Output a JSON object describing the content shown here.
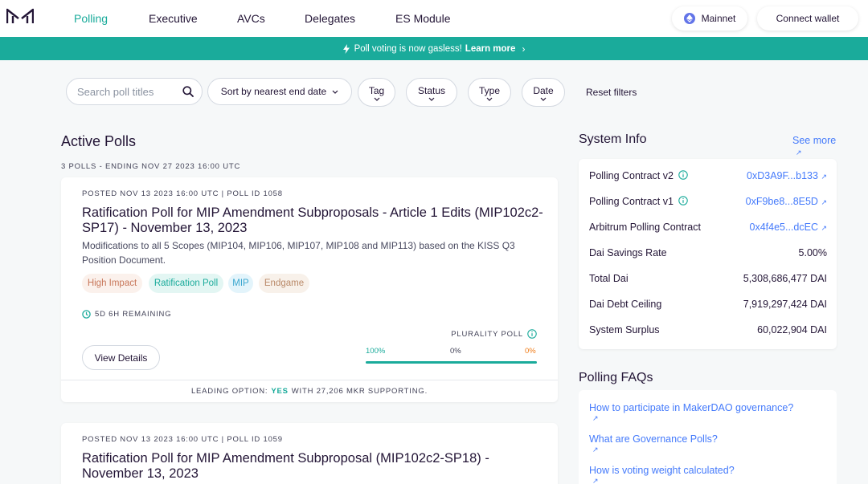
{
  "nav": {
    "items": [
      {
        "label": "Polling",
        "active": true
      },
      {
        "label": "Executive",
        "active": false
      },
      {
        "label": "AVCs",
        "active": false
      },
      {
        "label": "Delegates",
        "active": false
      },
      {
        "label": "ES Module",
        "active": false
      }
    ],
    "network_label": "Mainnet",
    "connect_label": "Connect wallet"
  },
  "banner": {
    "text": "Poll voting is now gasless!",
    "link_text": "Learn more",
    "chevron": "›"
  },
  "filters": {
    "search_placeholder": "Search poll titles",
    "sort_label": "Sort by nearest end date",
    "tag_label": "Tag",
    "status_label": "Status",
    "type_label": "Type",
    "date_label": "Date",
    "reset_label": "Reset filters"
  },
  "polls": {
    "title": "Active Polls",
    "subhead": "3 POLLS - ENDING NOV 27 2023 16:00 UTC",
    "items": [
      {
        "posted": "POSTED NOV 13 2023 16:00 UTC | POLL ID 1058",
        "title": "Ratification Poll for MIP Amendment Subproposals - Article 1 Edits (MIP102c2-SP17) - November 13, 2023",
        "description": "Modifications to all 5 Scopes (MIP104, MIP106, MIP107, MIP108 and MIP113) based on the KISS Q3 Position Document.",
        "tags": [
          "High Impact",
          "Ratification Poll",
          "MIP",
          "Endgame"
        ],
        "remaining": "5D 6H REMAINING",
        "view_label": "View Details",
        "poll_type": "PLURALITY POLL",
        "percents": [
          "100%",
          "0%",
          "0%"
        ],
        "progress": 1.0,
        "leading_prefix": "LEADING OPTION:",
        "leading_option": "YES",
        "leading_suffix": "WITH 27,206 MKR SUPPORTING."
      },
      {
        "posted": "POSTED NOV 13 2023 16:00 UTC | POLL ID 1059",
        "title": "Ratification Poll for MIP Amendment Subproposal (MIP102c2-SP18) - November 13, 2023"
      }
    ]
  },
  "system_info": {
    "title": "System Info",
    "see_more": "See more",
    "rows": [
      {
        "label": "Polling Contract v2",
        "value": "0xD3A9F...b133"
      },
      {
        "label": "Polling Contract v1",
        "value": "0xF9be8...8E5D"
      },
      {
        "label": "Arbitrum Polling Contract",
        "value": "0x4f4e5...dcEC"
      },
      {
        "label": "Dai Savings Rate",
        "value": "5.00%"
      },
      {
        "label": "Total Dai",
        "value": "5,308,686,477 DAI"
      },
      {
        "label": "Dai Debt Ceiling",
        "value": "7,919,297,424 DAI"
      },
      {
        "label": "System Surplus",
        "value": "60,022,904 DAI"
      }
    ]
  },
  "faqs": {
    "title": "Polling FAQs",
    "items": [
      "How to participate in MakerDAO governance?",
      "What are Governance Polls?",
      "How is voting weight calculated?"
    ]
  },
  "colors": {
    "accent": "#1aab9b",
    "link": "#447afb",
    "text": "#231536",
    "background": "#f6f8f9",
    "high_impact": "#c8775a",
    "orange_pct": "#f07c18"
  }
}
